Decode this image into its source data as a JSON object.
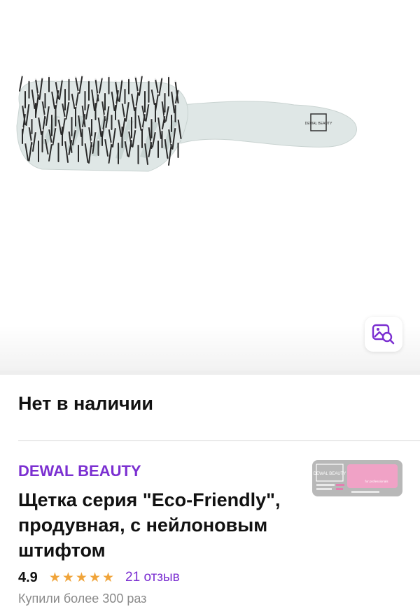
{
  "product": {
    "availability": "Нет в наличии",
    "brand": "DEWAL BEAUTY",
    "title": "Щетка серия \"Eco-Friendly\", продувная, с нейлоновым штифтом",
    "rating": "4.9",
    "stars": 5,
    "reviews_label": "21 отзыв",
    "bought_label": "Купили более 300 раз"
  },
  "image_logo": {
    "brush_logo": "DEWAL BEAUTY",
    "tile_logo": "DEWAL BEAUTY",
    "tile_tagline": "for professionals"
  },
  "icons": {
    "visual_search": "image-search-icon",
    "star": "star-icon"
  },
  "colors": {
    "brand": "#7b2fd1",
    "star": "#f0a43a",
    "muted": "#8a8a8a",
    "brush": "#dfe7e6"
  }
}
